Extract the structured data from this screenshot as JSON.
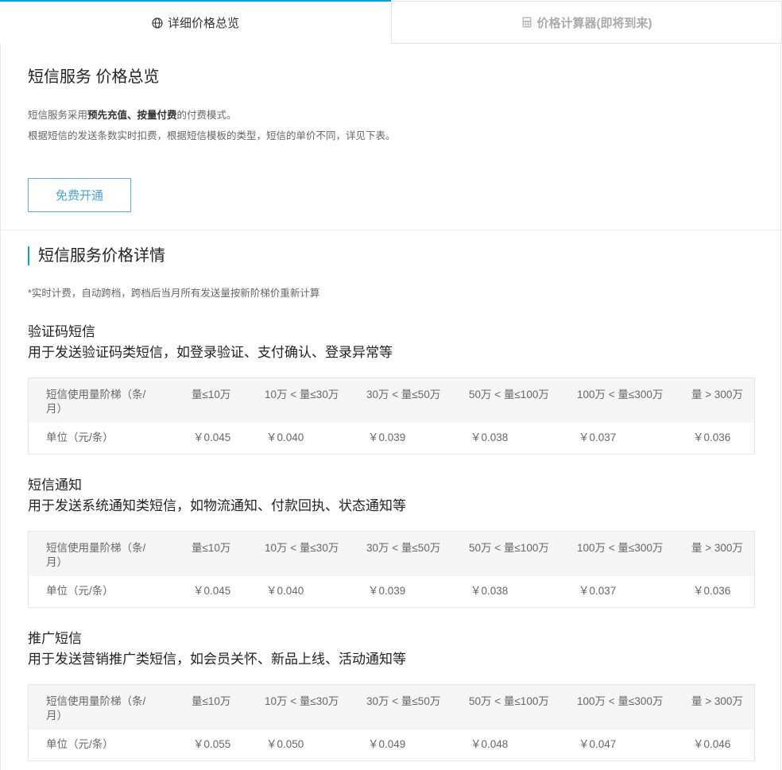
{
  "tabs": {
    "active_label": "详细价格总览",
    "active_icon": "globe-icon",
    "inactive_label": "价格计算器(即将到来)",
    "inactive_icon": "calculator-icon"
  },
  "overview": {
    "title": "短信服务 价格总览",
    "line1_pre": "短信服务采用",
    "line1_bold": "预先充值、按量付费",
    "line1_post": "的付费模式。",
    "line2": "根据短信的发送条数实时扣费，根据短信模板的类型，短信的单价不同，详见下表。",
    "button_label": "免费开通"
  },
  "details": {
    "title": "短信服务价格详情",
    "note": "*实时计费，自动跨档，跨档后当月所有发送量按新阶梯价重新计算",
    "header_label": "短信使用量阶梯（条/月）",
    "unit_label": "单位（元/条）",
    "tiers": [
      "量≤10万",
      "10万 < 量≤30万",
      "30万 < 量≤50万",
      "50万 < 量≤100万",
      "100万 < 量≤300万",
      "量 > 300万"
    ],
    "categories": [
      {
        "name": "验证码短信",
        "desc": "用于发送验证码类短信，如登录验证、支付确认、登录异常等",
        "prices": [
          "￥0.045",
          "￥0.040",
          "￥0.039",
          "￥0.038",
          "￥0.037",
          "￥0.036"
        ]
      },
      {
        "name": "短信通知",
        "desc": "用于发送系统通知类短信，如物流通知、付款回执、状态通知等",
        "prices": [
          "￥0.045",
          "￥0.040",
          "￥0.039",
          "￥0.038",
          "￥0.037",
          "￥0.036"
        ]
      },
      {
        "name": "推广短信",
        "desc": "用于发送营销推广类短信，如会员关怀、新品上线、活动通知等",
        "prices": [
          "￥0.055",
          "￥0.050",
          "￥0.049",
          "￥0.048",
          "￥0.047",
          "￥0.046"
        ]
      }
    ]
  }
}
